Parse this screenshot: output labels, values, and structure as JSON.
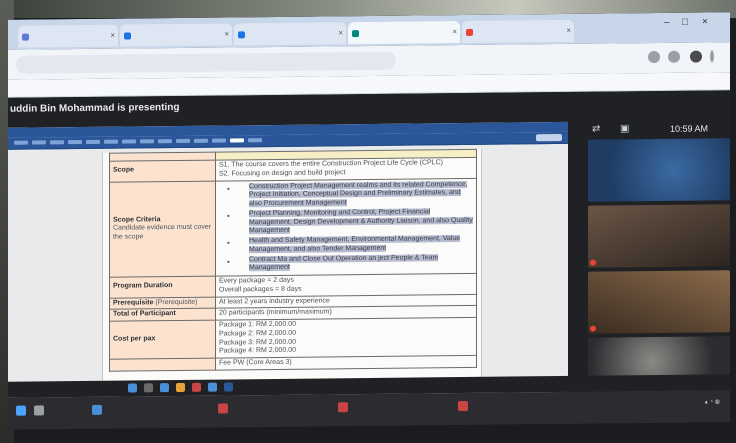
{
  "browser": {
    "tabs": [
      {
        "label": "",
        "icon": "tab-favicon-icon",
        "color": "#5b7bd5"
      },
      {
        "label": "",
        "icon": "tab-favicon-icon",
        "color": "#1a73e8"
      },
      {
        "label": "",
        "icon": "tab-favicon-icon",
        "color": "#1a73e8"
      },
      {
        "label": "",
        "icon": "meet-icon",
        "color": "#00897b"
      },
      {
        "label": "",
        "icon": "tab-favicon-icon",
        "color": "#ea4335"
      }
    ],
    "address": "",
    "bookmarks": [
      "",
      ""
    ]
  },
  "meet": {
    "presenting_text": "uddin Bin Mohammad is presenting",
    "time": "10:59 AM",
    "participants": [
      {
        "name": "",
        "bg": "#1f3d63"
      },
      {
        "name": "",
        "bg": "#4a3a30"
      },
      {
        "name": "",
        "bg": "#5a4632"
      },
      {
        "name": "",
        "bg": "#3a3c40"
      }
    ]
  },
  "document": {
    "rows": [
      {
        "label": "Scope",
        "lines": [
          "S1. The course covers the entire Construction Project Life Cycle (CPLC)",
          "S2. Focusing on design and build project"
        ]
      },
      {
        "label": "Scope Criteria",
        "caption": "Candidate evidence must cover the scope",
        "bullets": [
          "Construction Project Management realms and its related Competence, Project Initiation, Conceptual Design and Preliminary Estimates, and also Procurement Management",
          "Project Planning, Monitoring and Control, Project Financial Management, Design Development & Authority Liaison, and also Quality Management",
          "Health and Safety Management, Environmental Management, Value Management, and also Tender Management",
          "Contract Ma                                          and Close Out Operation an                                      ject People & Team Management"
        ]
      },
      {
        "label": "Program Duration",
        "lines": [
          "Every package = 2 days",
          "Overall packages = 8 days"
        ]
      },
      {
        "label": "Prerequisite",
        "suffix": "(Prerequisite)",
        "lines": [
          "At least 2 years industry experience"
        ]
      },
      {
        "label": "Total of Participant",
        "lines": [
          "20 participants (minimum/maximum)"
        ]
      },
      {
        "label": "Cost per pax",
        "lines": [
          "Package 1: RM 2,000.00",
          "Package 2: RM 2,000.00",
          "Package 3: RM 2,000.00",
          "Package 4: RM 2,000.00"
        ]
      }
    ],
    "footer_text": "Fee                                PW (Core Areas 3)"
  },
  "taskbar": {
    "items": [
      "",
      "",
      "",
      ""
    ]
  },
  "colors": {
    "word_blue": "#2b579a",
    "highlight": "#b8bdd2",
    "label_fill": "#fce3cf",
    "meet_dark": "#202124"
  }
}
